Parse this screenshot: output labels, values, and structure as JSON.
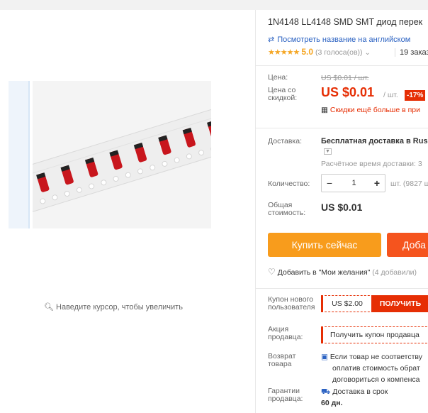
{
  "product": {
    "title": "1N4148 LL4148 SMD SMT диод перек",
    "translate_link": "Посмотреть название на английском",
    "rating_value": "5.0",
    "votes": "(3 голоса(ов))",
    "orders": "19 заказ"
  },
  "gallery": {
    "zoom_hint": "Наведите курсор, чтобы увеличить"
  },
  "price": {
    "label": "Цена:",
    "old_price": "US $0.01 / шт.",
    "discount_label_line1": "Цена со",
    "discount_label_line2": "скидкой:",
    "new_price": "US $0.01",
    "unit": "/ шт.",
    "discount_badge": "-17%",
    "promo_text": "Скидки ещё больше в при"
  },
  "shipping": {
    "label": "Доставка:",
    "value": "Бесплатная доставка в Russ",
    "time": "Расчётное время доставки: 3"
  },
  "quantity": {
    "label": "Количество:",
    "minus": "−",
    "value": "1",
    "plus": "+",
    "stock": "шт. (9827 ш"
  },
  "total": {
    "label_line1": "Общая",
    "label_line2": "стоимость:",
    "value": "US $0.01"
  },
  "actions": {
    "buy_now": "Купить сейчас",
    "add_to_cart": "Доба",
    "wishlist": "Добавить в \"Мои желания\"",
    "wishlist_count": "(4 добавили)"
  },
  "coupon": {
    "label_line1": "Купон нового",
    "label_line2": "пользователя",
    "amount": "US $2.00",
    "get_button": "ПОЛУЧИТЬ"
  },
  "seller_promo": {
    "label_line1": "Акция",
    "label_line2": "продавца:",
    "button": "Получить купон продавца"
  },
  "returns": {
    "label_line1": "Возврат",
    "label_line2": "товара",
    "line1": "Если товар не соответству",
    "line2": "оплатив стоимость обрат",
    "line3": "договориться о компенса"
  },
  "guarantee": {
    "label_line1": "Гарантии",
    "label_line2": "продавца:",
    "line1": "Доставка в срок",
    "line2": "60 дн."
  },
  "colors": {
    "accent_red": "#e62e04",
    "buy_orange": "#f89c1c",
    "cart_orange": "#f5541e",
    "link_blue": "#2b62c2",
    "star_gold": "#f5a623"
  }
}
